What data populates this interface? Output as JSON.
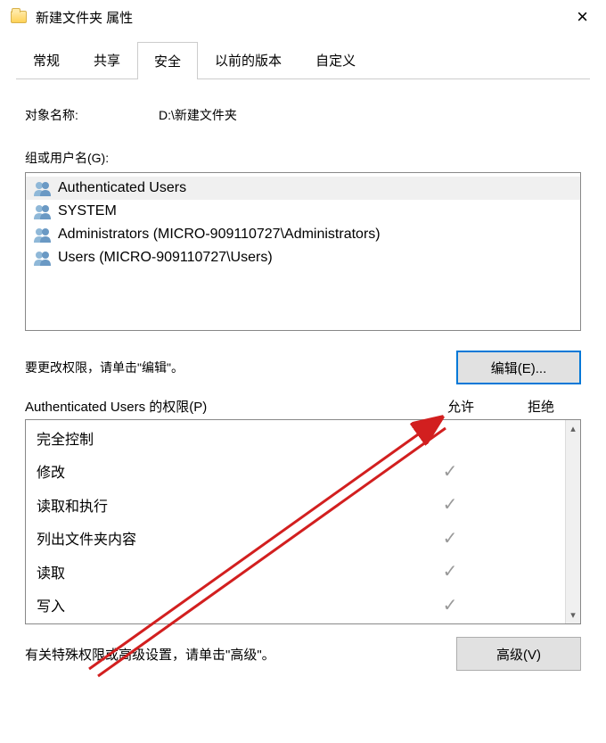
{
  "window": {
    "title": "新建文件夹 属性"
  },
  "tabs": [
    "常规",
    "共享",
    "安全",
    "以前的版本",
    "自定义"
  ],
  "active_tab_index": 2,
  "object": {
    "label": "对象名称:",
    "value": "D:\\新建文件夹"
  },
  "users_section": {
    "label": "组或用户名(G):",
    "items": [
      "Authenticated Users",
      "SYSTEM",
      "Administrators (MICRO-909110727\\Administrators)",
      "Users (MICRO-909110727\\Users)"
    ],
    "selected_index": 0
  },
  "edit_hint": "要更改权限，请单击\"编辑\"。",
  "edit_button": "编辑(E)...",
  "permissions_header": {
    "label": "Authenticated Users 的权限(P)",
    "allow": "允许",
    "deny": "拒绝"
  },
  "permissions": [
    {
      "name": "完全控制",
      "allow": false,
      "deny": false
    },
    {
      "name": "修改",
      "allow": true,
      "deny": false
    },
    {
      "name": "读取和执行",
      "allow": true,
      "deny": false
    },
    {
      "name": "列出文件夹内容",
      "allow": true,
      "deny": false
    },
    {
      "name": "读取",
      "allow": true,
      "deny": false
    },
    {
      "name": "写入",
      "allow": true,
      "deny": false
    }
  ],
  "advanced_hint": "有关特殊权限或高级设置，请单击\"高级\"。",
  "advanced_button": "高级(V)"
}
